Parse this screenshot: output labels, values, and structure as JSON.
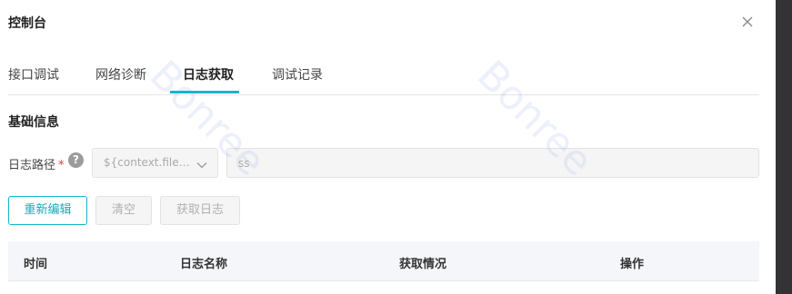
{
  "dialog": {
    "title": "控制台"
  },
  "tabs": [
    {
      "label": "接口调试",
      "active": false
    },
    {
      "label": "网络诊断",
      "active": false
    },
    {
      "label": "日志获取",
      "active": true
    },
    {
      "label": "调试记录",
      "active": false
    }
  ],
  "section": {
    "title": "基础信息"
  },
  "form": {
    "log_path_label": "日志路径",
    "required_mark": "*",
    "help_glyph": "?",
    "select_value": "${context.files...",
    "input_value": "ss"
  },
  "buttons": {
    "edit": "重新编辑",
    "clear": "清空",
    "fetch": "获取日志"
  },
  "table": {
    "columns": [
      "时间",
      "日志名称",
      "获取情况",
      "操作"
    ]
  },
  "watermark": {
    "text": "Bonree"
  },
  "colors": {
    "accent": "#14b6c8",
    "required": "#e5383b"
  },
  "icons": {
    "close": "close-icon",
    "select_arrow": "chevron-down-icon",
    "help": "question-circle-icon"
  }
}
